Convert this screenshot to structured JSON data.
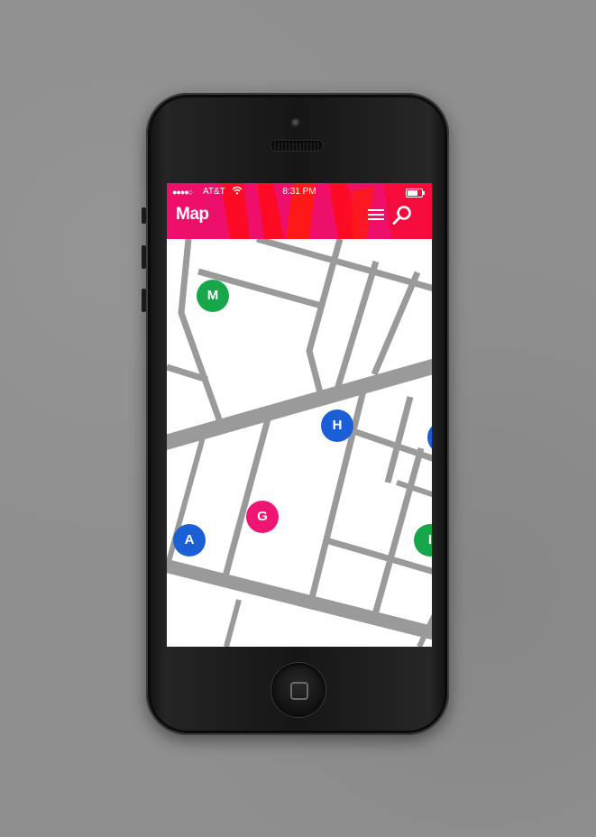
{
  "status_bar": {
    "signal": "●●●●○",
    "carrier": "AT&T",
    "wifi_icon": "wifi-icon",
    "time": "8:31 PM",
    "battery_level": 0.7
  },
  "header": {
    "title": "Map",
    "color": "#ee0f6b",
    "menu_icon": "hamburger-menu-icon",
    "search_icon": "search-icon"
  },
  "map": {
    "road_color": "#9a9a9a",
    "markers": [
      {
        "label": "M",
        "color": "#17a64a"
      },
      {
        "label": "H",
        "color": "#1b5fd6"
      },
      {
        "label": "G",
        "color": "#ee1672"
      },
      {
        "label": "A",
        "color": "#1b5fd6"
      },
      {
        "label": "I",
        "color": "#17a64a"
      },
      {
        "label": "",
        "color": "#1b5fd6"
      }
    ]
  },
  "device": {
    "home_button": "home-button"
  }
}
